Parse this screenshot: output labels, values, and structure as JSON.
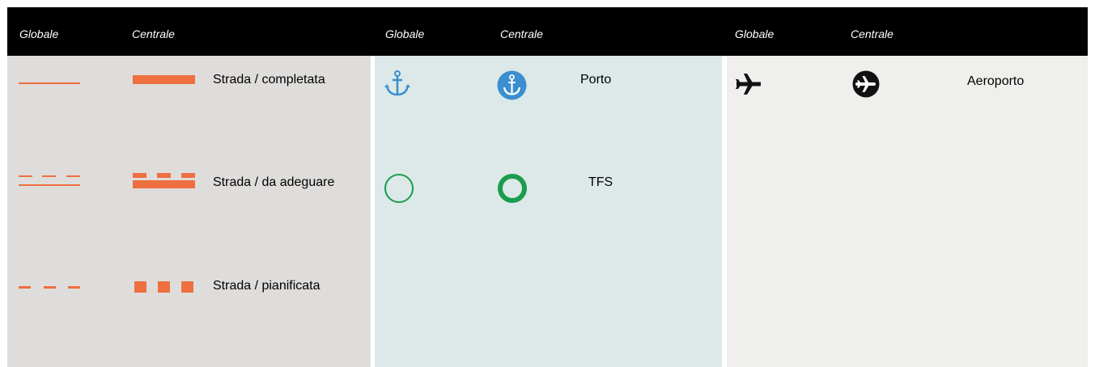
{
  "colors": {
    "header_bg": "#000000",
    "header_text": "#ffffff",
    "roads_bg": "#dfdddb",
    "ports_bg": "#dde9e8",
    "air_bg": "#efefed",
    "road_orange": "#ee6f3f",
    "port_blue": "#3b8fd0",
    "tfs_green": "#1a9c4c",
    "airport_black": "#111111"
  },
  "header": {
    "groups": [
      {
        "globale": "Globale",
        "centrale": "Centrale"
      },
      {
        "globale": "Globale",
        "centrale": "Centrale"
      },
      {
        "globale": "Globale",
        "centrale": "Centrale"
      }
    ]
  },
  "roads": {
    "items": [
      {
        "label": "Strada / completata",
        "icon": "road-completed-line"
      },
      {
        "label": "Strada / da adeguare",
        "icon": "road-upgrade-line"
      },
      {
        "label": "Strada / pianificata",
        "icon": "road-planned-line"
      }
    ]
  },
  "ports": {
    "items": [
      {
        "label": "Porto",
        "icon": "anchor-icon"
      },
      {
        "label": "TFS",
        "icon": "ring-icon"
      }
    ]
  },
  "air": {
    "items": [
      {
        "label": "Aeroporto",
        "icon": "airplane-icon"
      }
    ]
  }
}
